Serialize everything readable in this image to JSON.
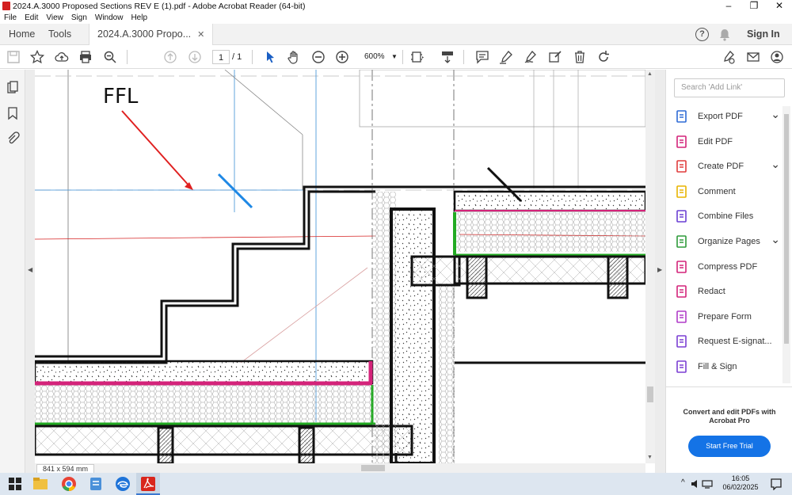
{
  "window": {
    "title": "2024.A.3000 Proposed Sections REV E (1).pdf - Adobe Acrobat Reader (64-bit)",
    "minimize": "–",
    "maximize": "❐",
    "close": "✕"
  },
  "menu": [
    "File",
    "Edit",
    "View",
    "Sign",
    "Window",
    "Help"
  ],
  "tabs": {
    "home": "Home",
    "tools": "Tools",
    "doc": "2024.A.3000 Propo...",
    "close": "✕",
    "signin": "Sign In"
  },
  "toolbar": {
    "page_current": "1",
    "page_total": "/ 1",
    "zoom": "600%"
  },
  "drawing": {
    "annotation_label": "FFL"
  },
  "status": {
    "page_size": "841 x 594 mm"
  },
  "right_pane": {
    "search_placeholder": "Search 'Add Link'",
    "tools": [
      {
        "label": "Export PDF",
        "icon": "export-pdf-icon",
        "color": "#2e6bd6",
        "chevron": true
      },
      {
        "label": "Edit PDF",
        "icon": "edit-pdf-icon",
        "color": "#d4237a",
        "chevron": false
      },
      {
        "label": "Create PDF",
        "icon": "create-pdf-icon",
        "color": "#e03c3c",
        "chevron": true
      },
      {
        "label": "Comment",
        "icon": "comment-icon",
        "color": "#e8b400",
        "chevron": false
      },
      {
        "label": "Combine Files",
        "icon": "combine-files-icon",
        "color": "#6a3fd4",
        "chevron": false
      },
      {
        "label": "Organize Pages",
        "icon": "organize-pages-icon",
        "color": "#2e9b3a",
        "chevron": true
      },
      {
        "label": "Compress PDF",
        "icon": "compress-pdf-icon",
        "color": "#d4237a",
        "chevron": false
      },
      {
        "label": "Redact",
        "icon": "redact-icon",
        "color": "#d4237a",
        "chevron": false
      },
      {
        "label": "Prepare Form",
        "icon": "prepare-form-icon",
        "color": "#b03cc8",
        "chevron": false
      },
      {
        "label": "Request E-signat...",
        "icon": "request-esign-icon",
        "color": "#7b3fd4",
        "chevron": false
      },
      {
        "label": "Fill & Sign",
        "icon": "fill-sign-icon",
        "color": "#7b3fd4",
        "chevron": false
      }
    ],
    "promo_text": "Convert and edit PDFs with Acrobat Pro",
    "promo_button": "Start Free Trial"
  },
  "taskbar": {
    "time": "16:05",
    "date": "06/02/2025"
  }
}
